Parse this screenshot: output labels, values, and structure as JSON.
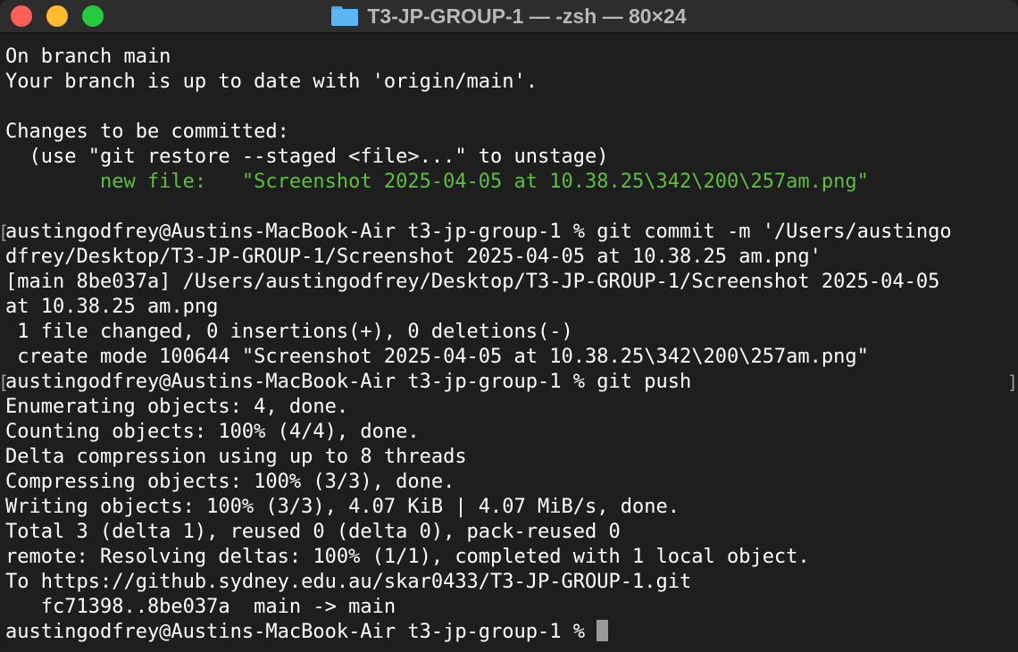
{
  "window": {
    "title": "T3-JP-GROUP-1 — -zsh — 80×24",
    "title_icon": "folder-icon",
    "controls": [
      "close-button",
      "minimize-button",
      "zoom-button"
    ]
  },
  "colors": {
    "background": "#1e1e1e",
    "titlebar": "#2d2d2d",
    "text": "#ffffff",
    "staged_file_green": "#5fbf3f",
    "close": "#ff5f57",
    "minimize": "#febc2e",
    "zoom": "#28c840"
  },
  "terminal": {
    "lines": [
      "On branch main",
      "Your branch is up to date with 'origin/main'.",
      "",
      "Changes to be committed:",
      "  (use \"git restore --staged <file>...\" to unstage)",
      "        new file:   \"Screenshot 2025-04-05 at 10.38.25\\342\\200\\257am.png\"",
      "",
      "austingodfrey@Austins-MacBook-Air t3-jp-group-1 % git commit -m '/Users/austingo",
      "dfrey/Desktop/T3-JP-GROUP-1/Screenshot 2025-04-05 at 10.38.25 am.png'",
      "[main 8be037a] /Users/austingodfrey/Desktop/T3-JP-GROUP-1/Screenshot 2025-04-05",
      "at 10.38.25 am.png",
      " 1 file changed, 0 insertions(+), 0 deletions(-)",
      " create mode 100644 \"Screenshot 2025-04-05 at 10.38.25\\342\\200\\257am.png\"",
      "austingodfrey@Austins-MacBook-Air t3-jp-group-1 % git push",
      "Enumerating objects: 4, done.",
      "Counting objects: 100% (4/4), done.",
      "Delta compression using up to 8 threads",
      "Compressing objects: 100% (3/3), done.",
      "Writing objects: 100% (3/3), 4.07 KiB | 4.07 MiB/s, done.",
      "Total 3 (delta 1), reused 0 (delta 0), pack-reused 0",
      "remote: Resolving deltas: 100% (1/1), completed with 1 local object.",
      "To https://github.sydney.edu.au/skar0433/T3-JP-GROUP-1.git",
      "   fc71398..8be037a  main -> main"
    ],
    "prompt": "austingodfrey@Austins-MacBook-Air t3-jp-group-1 % ",
    "highlighted_line_index": 5
  }
}
